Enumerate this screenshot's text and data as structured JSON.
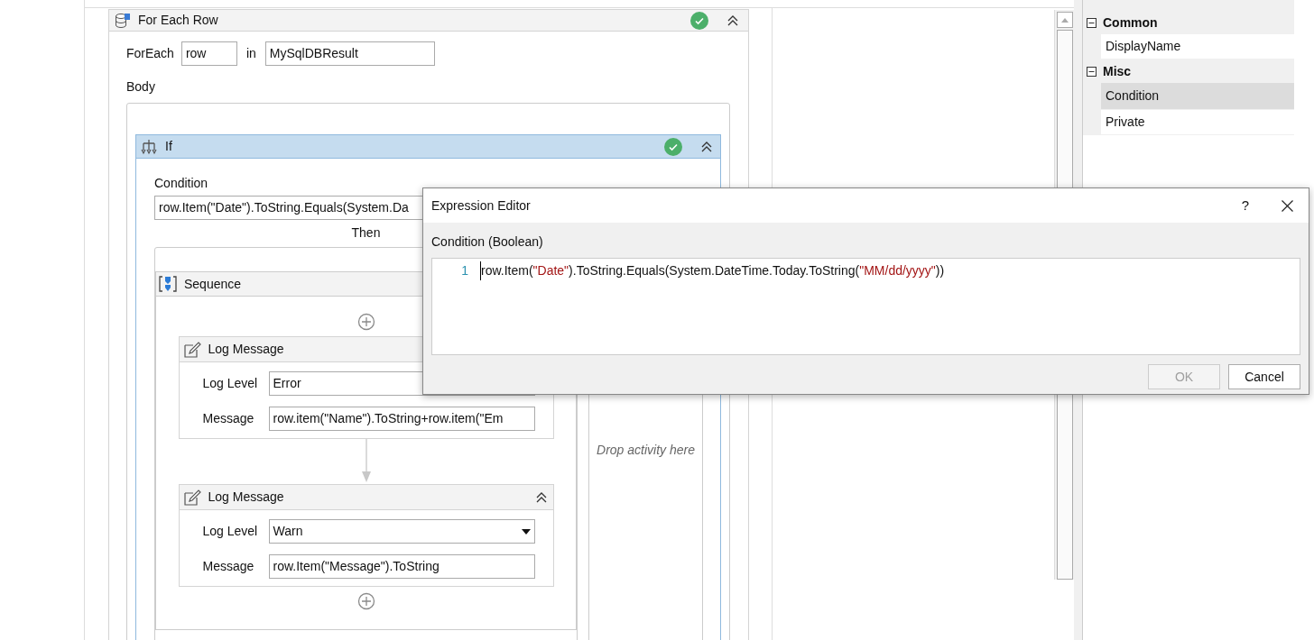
{
  "for_each": {
    "title": "For Each Row",
    "valid": true,
    "item_label": "ForEach",
    "item_value": "row",
    "in_label": "in",
    "source": "MySqlDBResult",
    "body_label": "Body"
  },
  "if": {
    "title": "If",
    "valid": true,
    "condition_label": "Condition",
    "condition_value": "row.Item(\"Date\").ToString.Equals(System.Da",
    "then_label": "Then",
    "else_placeholder": "Drop activity here"
  },
  "sequence": {
    "title": "Sequence",
    "activities": [
      {
        "title": "Log Message",
        "level_label": "Log Level",
        "level": "Error",
        "message_label": "Message",
        "message": "row.item(\"Name\").ToString+row.item(\"Em"
      },
      {
        "title": "Log Message",
        "level_label": "Log Level",
        "level": "Warn",
        "message_label": "Message",
        "message": "row.Item(\"Message\").ToString"
      }
    ]
  },
  "properties": [
    {
      "category": "Common",
      "expanded": true,
      "items": [
        {
          "label": "DisplayName",
          "selected": false
        }
      ]
    },
    {
      "category": "Misc",
      "expanded": true,
      "items": [
        {
          "label": "Condition",
          "selected": true
        },
        {
          "label": "Private",
          "selected": false
        }
      ]
    }
  ],
  "dialog": {
    "title": "Expression Editor",
    "help": "?",
    "label": "Condition (Boolean)",
    "line_number": "1",
    "code": [
      {
        "kind": "plain",
        "text": "row.Item("
      },
      {
        "kind": "string",
        "text": "\"Date\""
      },
      {
        "kind": "plain",
        "text": ").ToString.Equals(System.DateTime.Today.ToString("
      },
      {
        "kind": "string",
        "text": "\"MM/dd/yyyy\""
      },
      {
        "kind": "plain",
        "text": "))"
      }
    ],
    "buttons": [
      {
        "label": "OK",
        "disabled": true
      },
      {
        "label": "Cancel",
        "disabled": false
      }
    ]
  }
}
